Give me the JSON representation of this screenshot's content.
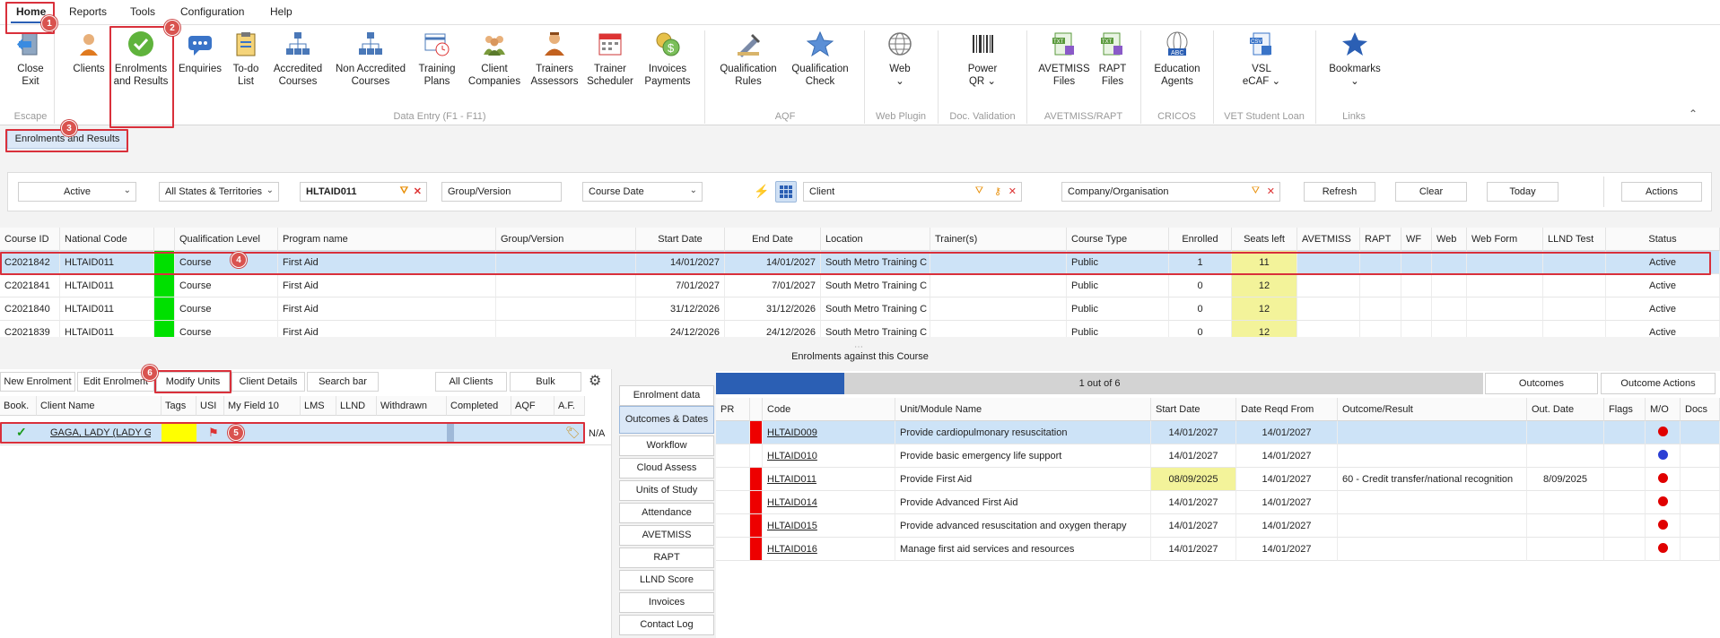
{
  "menu": {
    "items": [
      "Home",
      "Reports",
      "Tools",
      "Configuration",
      "Help"
    ]
  },
  "ribbon": {
    "buttons": [
      {
        "line1": "Close",
        "line2": "Exit",
        "icon": "exit-icon"
      },
      {
        "line1": "Clients",
        "line2": "",
        "icon": "client-person-icon"
      },
      {
        "line1": "Enrolments",
        "line2": "and Results",
        "icon": "green-check-icon"
      },
      {
        "line1": "Enquiries",
        "line2": "",
        "icon": "chat-bubble-icon"
      },
      {
        "line1": "To-do",
        "line2": "List",
        "icon": "clipboard-icon"
      },
      {
        "line1": "Accredited",
        "line2": "Courses",
        "icon": "org-chart-icon"
      },
      {
        "line1": "Non Accredited",
        "line2": "Courses",
        "icon": "org-chart-icon"
      },
      {
        "line1": "Training",
        "line2": "Plans",
        "icon": "calendar-clock-icon"
      },
      {
        "line1": "Client",
        "line2": "Companies",
        "icon": "group-icon"
      },
      {
        "line1": "Trainers",
        "line2": "Assessors",
        "icon": "trainer-icon"
      },
      {
        "line1": "Trainer",
        "line2": "Scheduler",
        "icon": "calendar-icon"
      },
      {
        "line1": "Invoices",
        "line2": "Payments",
        "icon": "coins-icon"
      },
      {
        "line1": "Qualification",
        "line2": "Rules",
        "icon": "pen-ruler-icon"
      },
      {
        "line1": "Qualification",
        "line2": "Check",
        "icon": "star-icon"
      },
      {
        "line1": "Web",
        "line2": "⌄",
        "icon": "globe-icon"
      },
      {
        "line1": "Power",
        "line2": "QR ⌄",
        "icon": "barcode-icon"
      },
      {
        "line1": "AVETMISS",
        "line2": "Files",
        "icon": "txt-file-icon"
      },
      {
        "line1": "RAPT",
        "line2": "Files",
        "icon": "txt-file-icon"
      },
      {
        "line1": "Education",
        "line2": "Agents",
        "icon": "abc-globe-icon"
      },
      {
        "line1": "VSL",
        "line2": "eCAF ⌄",
        "icon": "csv-file-icon"
      },
      {
        "line1": "Bookmarks",
        "line2": "⌄",
        "icon": "bookmark-star-icon"
      }
    ],
    "groups": [
      "Escape",
      "Data Entry (F1 - F11)",
      "AQF",
      "Web Plugin",
      "Doc. Validation",
      "AVETMISS/RAPT",
      "CRICOS",
      "VET Student Loan",
      "Links"
    ]
  },
  "doc_tab": "Enrolments and Results",
  "badges": [
    "1",
    "2",
    "3",
    "4",
    "5",
    "6"
  ],
  "filters": {
    "status": "Active",
    "states": "All States & Territories",
    "code": "HLTAID011",
    "group_placeholder": "Group/Version",
    "date_type": "Course Date",
    "client_placeholder": "Client",
    "company_placeholder": "Company/Organisation",
    "refresh": "Refresh",
    "clear": "Clear",
    "today": "Today",
    "actions": "Actions"
  },
  "courses": {
    "columns": [
      "Course ID",
      "National Code",
      "",
      "Qualification Level",
      "Program name",
      "Group/Version",
      "Start Date",
      "End Date",
      "Location",
      "Trainer(s)",
      "Course Type",
      "Enrolled",
      "Seats left",
      "AVETMISS",
      "RAPT",
      "WF",
      "Web",
      "Web Form",
      "LLND Test",
      "Status"
    ],
    "rows": [
      [
        "C2021842",
        "HLTAID011",
        "",
        "Course",
        "First Aid",
        "",
        "14/01/2027",
        "14/01/2027",
        "South Metro Training C",
        "",
        "Public",
        "1",
        "11",
        "",
        "",
        "",
        "",
        "",
        "",
        "Active"
      ],
      [
        "C2021841",
        "HLTAID011",
        "",
        "Course",
        "First Aid",
        "",
        "7/01/2027",
        "7/01/2027",
        "South Metro Training C",
        "",
        "Public",
        "0",
        "12",
        "",
        "",
        "",
        "",
        "",
        "",
        "Active"
      ],
      [
        "C2021840",
        "HLTAID011",
        "",
        "Course",
        "First Aid",
        "",
        "31/12/2026",
        "31/12/2026",
        "South Metro Training C",
        "",
        "Public",
        "0",
        "12",
        "",
        "",
        "",
        "",
        "",
        "",
        "Active"
      ],
      [
        "C2021839",
        "HLTAID011",
        "",
        "Course",
        "First Aid",
        "",
        "24/12/2026",
        "24/12/2026",
        "South Metro Training C",
        "",
        "Public",
        "0",
        "12",
        "",
        "",
        "",
        "",
        "",
        "",
        "Active"
      ]
    ]
  },
  "enrolments_title": "Enrolments against this Course",
  "enrol_toolbar": {
    "new": "New Enrolment",
    "edit": "Edit Enrolment",
    "modify": "Modify Units",
    "details": "Client Details",
    "search": "Search bar",
    "all": "All Clients",
    "bulk": "Bulk"
  },
  "enrolments": {
    "columns": [
      "Book.",
      "Client Name",
      "Tags",
      "USI",
      "My Field 10",
      "LMS",
      "LLND",
      "Withdrawn",
      "Completed",
      "AQF",
      "A.F."
    ],
    "row": {
      "client": "GAGA, LADY (LADY GAGA)",
      "na": "N/A"
    }
  },
  "side_tabs": [
    "Enrolment data",
    "Outcomes & Dates",
    "Workflow",
    "Cloud Assess",
    "Units of Study",
    "Attendance",
    "AVETMISS",
    "RAPT",
    "LLND Score",
    "Invoices",
    "Contact Log"
  ],
  "outcomes_bar": {
    "progress_text": "1 out of 6",
    "progress_fraction": 0.1667,
    "outcomes": "Outcomes",
    "outcome_actions": "Outcome Actions"
  },
  "units": {
    "columns": [
      "PR",
      "",
      "Code",
      "Unit/Module Name",
      "Start Date",
      "Date Reqd From",
      "Outcome/Result",
      "Out. Date",
      "Flags",
      "M/O",
      "Docs"
    ],
    "rows": [
      {
        "code": "HLTAID009",
        "name": "Provide cardiopulmonary resuscitation",
        "start": "14/01/2027",
        "reqd": "14/01/2027",
        "outcome": "",
        "outdate": "",
        "flag": true,
        "dot": "#e00000"
      },
      {
        "code": "HLTAID010",
        "name": "Provide basic emergency life support",
        "start": "14/01/2027",
        "reqd": "14/01/2027",
        "outcome": "",
        "outdate": "",
        "flag": false,
        "dot": "#2b3fd4"
      },
      {
        "code": "HLTAID011",
        "name": "Provide First Aid",
        "start": "08/09/2025",
        "reqd": "14/01/2027",
        "outcome": "60 - Credit transfer/national recognition",
        "outdate": "8/09/2025",
        "flag": true,
        "dot": "#e00000"
      },
      {
        "code": "HLTAID014",
        "name": "Provide Advanced First Aid",
        "start": "14/01/2027",
        "reqd": "14/01/2027",
        "outcome": "",
        "outdate": "",
        "flag": true,
        "dot": "#e00000"
      },
      {
        "code": "HLTAID015",
        "name": "Provide advanced resuscitation and oxygen therapy",
        "start": "14/01/2027",
        "reqd": "14/01/2027",
        "outcome": "",
        "outdate": "",
        "flag": true,
        "dot": "#e00000"
      },
      {
        "code": "HLTAID016",
        "name": "Manage first aid services and resources",
        "start": "14/01/2027",
        "reqd": "14/01/2027",
        "outcome": "",
        "outdate": "",
        "flag": true,
        "dot": "#e00000"
      }
    ]
  },
  "colors": {
    "accent": "#2b5fb4",
    "callout": "#d9303b",
    "selection": "#cde3f7",
    "green": "#00e000",
    "seat_yellow": "#f3f39a",
    "flag_red": "#ee0000"
  }
}
